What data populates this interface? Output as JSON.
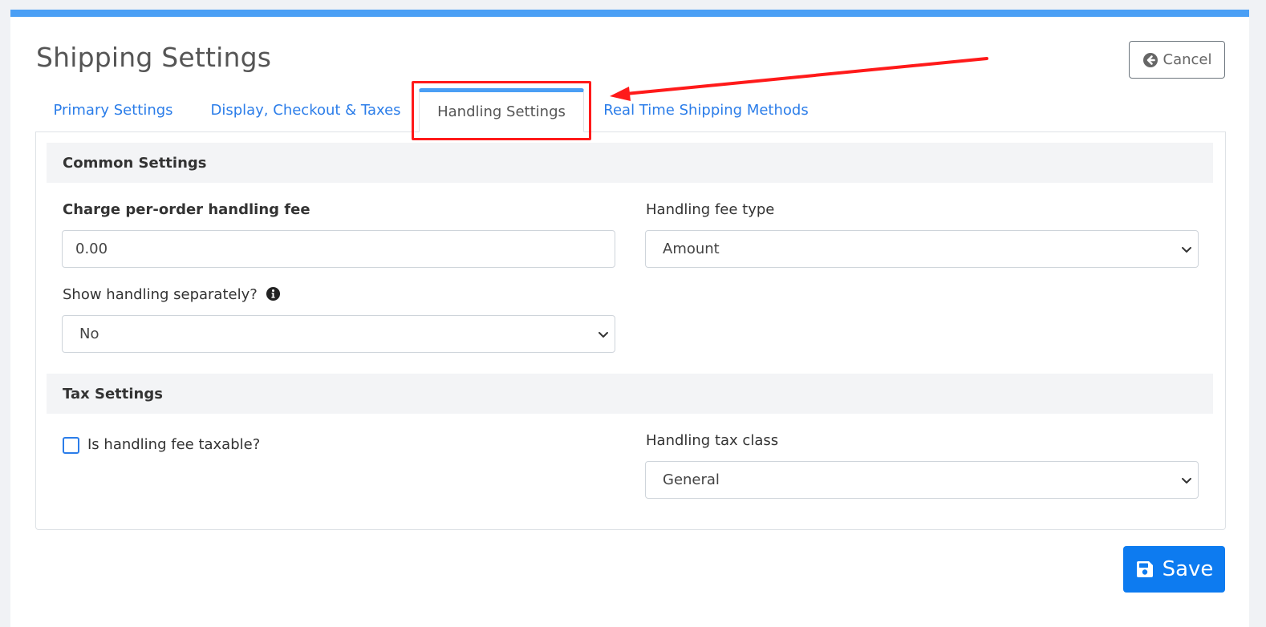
{
  "page": {
    "title": "Shipping Settings",
    "cancel_label": "Cancel",
    "save_label": "Save"
  },
  "tabs": [
    {
      "label": "Primary Settings",
      "active": false
    },
    {
      "label": "Display, Checkout & Taxes",
      "active": false
    },
    {
      "label": "Handling Settings",
      "active": true
    },
    {
      "label": "Real Time Shipping Methods",
      "active": false
    }
  ],
  "common_settings": {
    "header": "Common Settings",
    "handling_fee": {
      "label": "Charge per-order handling fee",
      "value": "0.00"
    },
    "handling_fee_type": {
      "label": "Handling fee type",
      "selected": "Amount"
    },
    "show_separately": {
      "label": "Show handling separately?",
      "selected": "No"
    }
  },
  "tax_settings": {
    "header": "Tax Settings",
    "taxable": {
      "label": "Is handling fee taxable?",
      "checked": false
    },
    "tax_class": {
      "label": "Handling tax class",
      "selected": "General"
    }
  },
  "icons": {
    "cancel": "arrow-circle-left-icon",
    "info": "info-circle-icon",
    "save": "floppy-disk-icon",
    "dropdown": "chevron-down-icon"
  },
  "colors": {
    "accent": "#4a9ff5",
    "link": "#2b7de9",
    "primary_button": "#0d7bf0",
    "annotation": "#ff1a1a"
  }
}
